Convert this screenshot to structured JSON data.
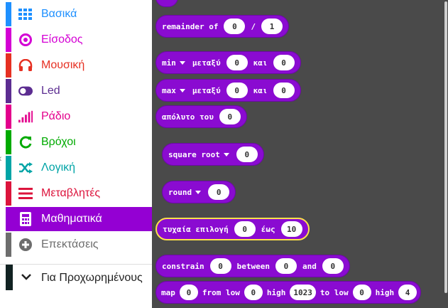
{
  "toolbox": {
    "categories": [
      {
        "label": "Βασικά",
        "color": "#1e90ff",
        "icon": "grid-icon"
      },
      {
        "label": "Είσοδος",
        "color": "#d400d4",
        "icon": "target-icon"
      },
      {
        "label": "Μουσική",
        "color": "#e63022",
        "icon": "headphones-icon"
      },
      {
        "label": "Led",
        "color": "#5c2d91",
        "icon": "toggle-icon"
      },
      {
        "label": "Ράδιο",
        "color": "#e3008c",
        "icon": "signal-bars-icon"
      },
      {
        "label": "Βρόχοι",
        "color": "#00aa00",
        "icon": "refresh-icon"
      },
      {
        "label": "Λογική",
        "color": "#00a4a6",
        "icon": "shuffle-icon"
      },
      {
        "label": "Μεταβλητές",
        "color": "#dc143c",
        "icon": "list-icon"
      },
      {
        "label": "Μαθηματικά",
        "color": "#9400d3",
        "icon": "calculator-icon"
      },
      {
        "label": "Επεκτάσεις",
        "color": "#6d6d6d",
        "icon": "plus-circle-icon"
      }
    ],
    "advanced_label": "Για Προχωρημένους"
  },
  "blocks": {
    "remainder": {
      "label": "remainder of",
      "a": "0",
      "sep": "/",
      "b": "1"
    },
    "min": {
      "op": "min",
      "between": "μεταξύ",
      "a": "0",
      "and": "και",
      "b": "0"
    },
    "max": {
      "op": "max",
      "between": "μεταξύ",
      "a": "0",
      "and": "και",
      "b": "0"
    },
    "abs": {
      "label": "απόλυτο του",
      "a": "0"
    },
    "sqrt": {
      "op": "square root",
      "a": "0"
    },
    "round": {
      "op": "round",
      "a": "0"
    },
    "random": {
      "label": "τυχαία επιλογή",
      "a": "0",
      "to": "έως",
      "b": "10"
    },
    "constrain": {
      "label": "constrain",
      "a": "0",
      "between": "between",
      "b": "0",
      "and": "and",
      "c": "0"
    },
    "map": {
      "label": "map",
      "value": "0",
      "from_low_label": "from low",
      "from_low": "0",
      "high_label": "high",
      "from_high": "1023",
      "to_low_label": "to low",
      "to_low": "0",
      "high2_label": "high",
      "to_high": "4"
    }
  },
  "colors": {
    "math_block": "#8a0bd1",
    "flyout_bg": "#4a4a4a",
    "highlight": "#ffe14a"
  }
}
